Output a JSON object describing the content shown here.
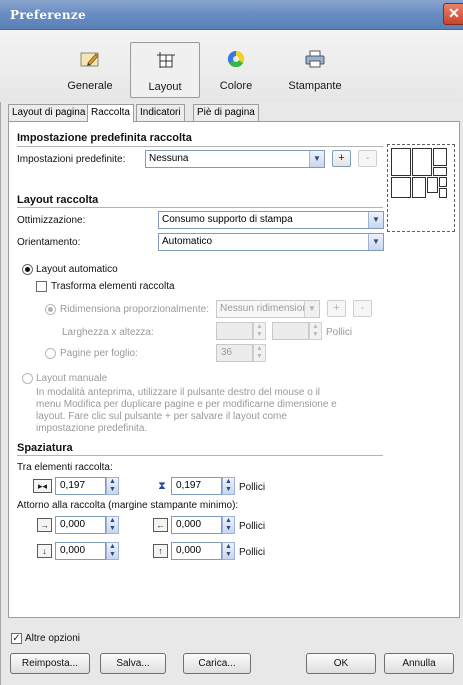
{
  "window": {
    "title": "Preferenze",
    "close_glyph": "✕"
  },
  "categories": [
    {
      "label": "Generale",
      "icon": "pencil-icon"
    },
    {
      "label": "Layout",
      "icon": "layout-icon",
      "selected": true
    },
    {
      "label": "Colore",
      "icon": "color-wheel-icon"
    },
    {
      "label": "Stampante",
      "icon": "printer-icon"
    }
  ],
  "tabs": [
    "Layout di pagina",
    "Raccolta",
    "Indicatori",
    "Piè di pagina"
  ],
  "selected_tab": "Raccolta",
  "preset": {
    "section_title": "Impostazione predefinita raccolta",
    "label": "Impostazioni predefinite:",
    "value": "Nessuna",
    "add_label": "+",
    "remove_label": "-"
  },
  "layout": {
    "section_title": "Layout raccolta",
    "optimization_label": "Ottimizzazione:",
    "optimization_value": "Consumo supporto di stampa",
    "orientation_label": "Orientamento:",
    "orientation_value": "Automatico",
    "auto_label": "Layout automatico",
    "transform_label": "Trasforma elementi raccolta",
    "scale_label": "Ridimensiona proporzionalmente:",
    "scale_value": "Nessun ridimension",
    "wh_label": "Larghezza x altezza:",
    "wh_unit": "Pollici",
    "pages_label": "Pagine per foglio:",
    "pages_value": "36",
    "manual_label": "Layout manuale",
    "manual_desc_1": "In modalità anteprima, utilizzare il pulsante destro del mouse o il",
    "manual_desc_2": "menu Modifica per duplicare pagine e per modificarne dimensione e",
    "manual_desc_3": "layout. Fare clic sul pulsante + per salvare il layout come",
    "manual_desc_4": "impostazione predefinita."
  },
  "spacing": {
    "section_title": "Spaziatura",
    "between_label": "Tra elementi raccolta:",
    "h_value": "0,197",
    "v_value": "0,197",
    "unit": "Pollici",
    "around_label": "Attorno alla raccolta (margine stampante minimo):",
    "left_value": "0,000",
    "right_value": "0,000",
    "top_value": "0,000",
    "bottom_value": "0,000",
    "unit2": "Pollici",
    "unit3": "Pollici"
  },
  "more_options_label": "Altre opzioni",
  "buttons": {
    "reset": "Reimposta...",
    "save": "Salva...",
    "load": "Carica...",
    "ok": "OK",
    "cancel": "Annulla"
  },
  "glyphs": {
    "dropdown": "▼",
    "spin_up": "▲",
    "spin_down": "▼",
    "check": "✓"
  },
  "colors": {
    "titlebar": "#6a8ec2",
    "close": "#c8452c",
    "field_border": "#7f9db9",
    "disabled_text": "#9a9a9a"
  }
}
